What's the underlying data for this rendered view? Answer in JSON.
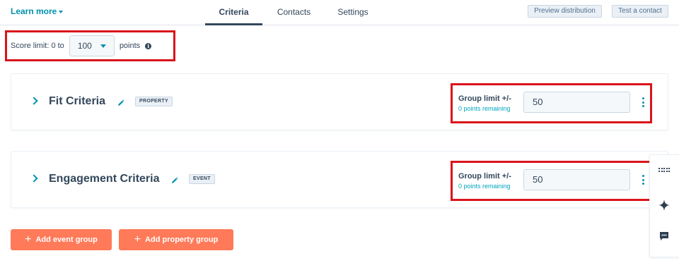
{
  "header": {
    "learn_more": "Learn more",
    "tabs": [
      {
        "label": "Criteria",
        "active": true
      },
      {
        "label": "Contacts",
        "active": false
      },
      {
        "label": "Settings",
        "active": false
      }
    ],
    "preview_button": "Preview distribution",
    "test_button": "Test a contact"
  },
  "score_limit": {
    "label": "Score limit: 0 to",
    "value": "100",
    "suffix": "points",
    "info_icon": "info-icon"
  },
  "groups": [
    {
      "title": "Fit Criteria",
      "tag": "PROPERTY",
      "group_limit_label": "Group limit +/-",
      "remaining": "0 points remaining",
      "limit_value": "50"
    },
    {
      "title": "Engagement Criteria",
      "tag": "EVENT",
      "group_limit_label": "Group limit +/-",
      "remaining": "0 points remaining",
      "limit_value": "50"
    }
  ],
  "actions": {
    "add_event_group": "Add event group",
    "add_property_group": "Add property group"
  },
  "side_panel": {
    "icons": [
      "grid-icon",
      "sparkle-icon",
      "chat-icon"
    ]
  },
  "colors": {
    "accent": "#0091ae",
    "primary_button": "#ff7a59",
    "text": "#33475b",
    "highlight": "#d9141b"
  }
}
